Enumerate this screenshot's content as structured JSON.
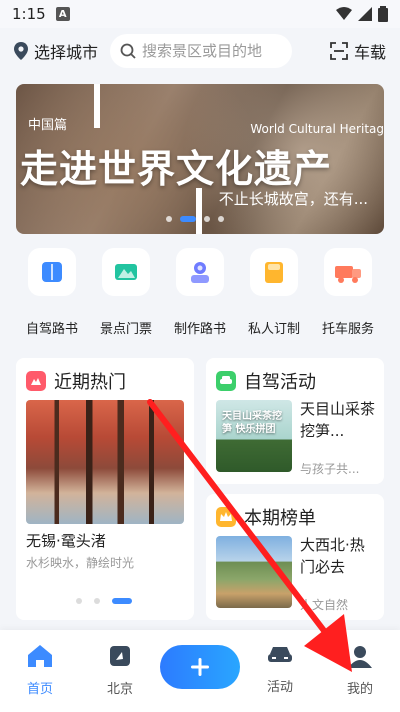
{
  "status_bar": {
    "time": "1:15",
    "notification_letter": "A"
  },
  "header": {
    "city_label": "选择城市",
    "search_placeholder": "搜索景区或目的地",
    "vehicle_label": "车载"
  },
  "banner": {
    "tag": "中国篇",
    "english": "World Cultural Heritag",
    "title": "走进世界文化遗产",
    "subtitle": "不止长城故宫，还有..."
  },
  "quick_entries": [
    {
      "label": "自驾路书",
      "icon": "book-icon",
      "color": "#3d8bff"
    },
    {
      "label": "景点门票",
      "icon": "mountain-ticket-icon",
      "color": "#22c4a0"
    },
    {
      "label": "制作路书",
      "icon": "person-book-icon",
      "color": "#6f7cff"
    },
    {
      "label": "私人订制",
      "icon": "custom-folder-icon",
      "color": "#ffb62e"
    },
    {
      "label": "托车服务",
      "icon": "truck-icon",
      "color": "#ff7a5c"
    }
  ],
  "hot_card": {
    "heading": "近期热门",
    "icon_color": "#ff5a6a",
    "title": "无锡·鼋头渚",
    "description": "水杉映水，静绘时光"
  },
  "activity_card": {
    "heading": "自驾活动",
    "icon_color": "#3ccf6b",
    "thumb_text": "天目山采茶挖笋 快乐拼团",
    "title": "天目山采茶挖笋...",
    "meta": "与孩子共..."
  },
  "ranking_card": {
    "heading": "本期榜单",
    "icon_color": "#ffb62e",
    "title": "大西北·热门必去",
    "meta": "人文自然"
  },
  "bottom_nav": [
    {
      "label": "首页",
      "icon": "home-icon",
      "active": true
    },
    {
      "label": "北京",
      "icon": "map-icon",
      "active": false
    },
    {
      "label": "",
      "icon": "plus-icon",
      "active": false
    },
    {
      "label": "活动",
      "icon": "car-icon",
      "active": false
    },
    {
      "label": "我的",
      "icon": "user-icon",
      "active": false
    }
  ],
  "colors": {
    "accent": "#3d8bff",
    "annotation_arrow": "#ff1f1f",
    "background": "#f3f5f9"
  }
}
